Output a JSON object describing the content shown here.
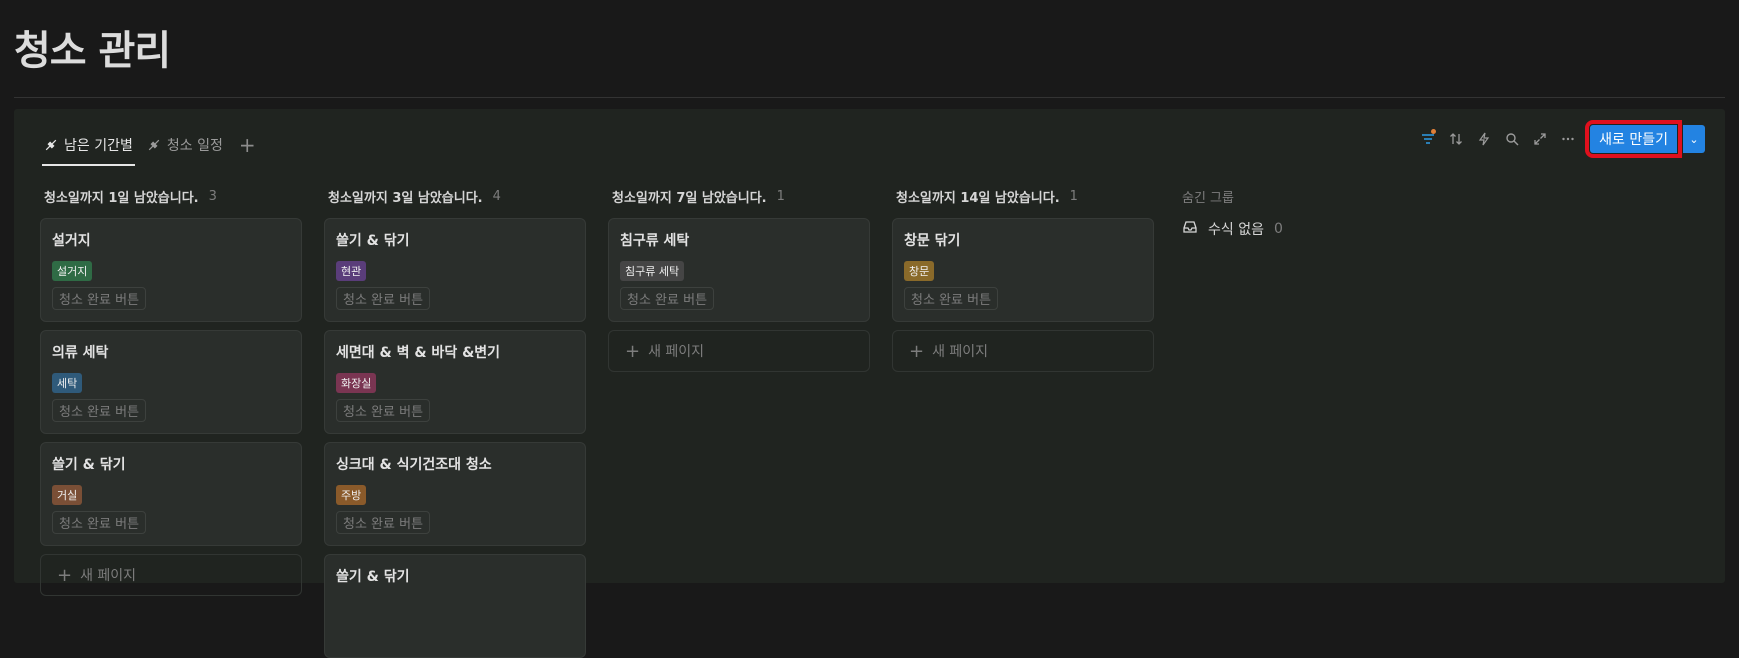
{
  "page": {
    "title": "청소 관리"
  },
  "tabs": [
    {
      "label": "남은 기간별",
      "active": true
    },
    {
      "label": "청소 일정",
      "active": false
    }
  ],
  "toolbar": {
    "icons": [
      "filter-icon",
      "sort-icon",
      "automation-icon",
      "search-icon",
      "expand-icon",
      "more-icon"
    ],
    "new_label": "새로 만들기"
  },
  "columns": [
    {
      "title": "청소일까지 1일 남았습니다.",
      "count": "3",
      "cards": [
        {
          "title": "설거지",
          "tag": "설거지",
          "tag_color": "#2f6b45",
          "button": "청소 완료 버튼"
        },
        {
          "title": "의류 세탁",
          "tag": "세탁",
          "tag_color": "#2f5a7a",
          "button": "청소 완료 버튼"
        },
        {
          "title": "쓸기 & 닦기",
          "tag": "거실",
          "tag_color": "#7a4f36",
          "button": "청소 완료 버튼"
        }
      ],
      "new_page": "새 페이지"
    },
    {
      "title": "청소일까지 3일 남았습니다.",
      "count": "4",
      "cards": [
        {
          "title": "쓸기 & 닦기",
          "tag": "현관",
          "tag_color": "#5a3d7a",
          "button": "청소 완료 버튼"
        },
        {
          "title": "세면대 & 벽 & 바닥 &변기",
          "tag": "화장실",
          "tag_color": "#7a3552",
          "button": "청소 완료 버튼"
        },
        {
          "title": "싱크대 & 식기건조대 청소",
          "tag": "주방",
          "tag_color": "#8a5a2a",
          "button": "청소 완료 버튼"
        },
        {
          "title": "쓸기 & 닦기",
          "tag": "",
          "tag_color": "",
          "button": ""
        }
      ]
    },
    {
      "title": "청소일까지 7일 남았습니다.",
      "count": "1",
      "cards": [
        {
          "title": "침구류 세탁",
          "tag": "침구류 세탁",
          "tag_color": "#454545",
          "button": "청소 완료 버튼"
        }
      ],
      "new_page": "새 페이지"
    },
    {
      "title": "청소일까지 14일 남았습니다.",
      "count": "1",
      "cards": [
        {
          "title": "창문 닦기",
          "tag": "창문",
          "tag_color": "#8a6a2a",
          "button": "청소 완료 버튼"
        }
      ],
      "new_page": "새 페이지"
    }
  ],
  "hidden_groups": {
    "title": "숨긴 그룹",
    "items": [
      {
        "label": "수식 없음",
        "count": "0"
      }
    ]
  }
}
